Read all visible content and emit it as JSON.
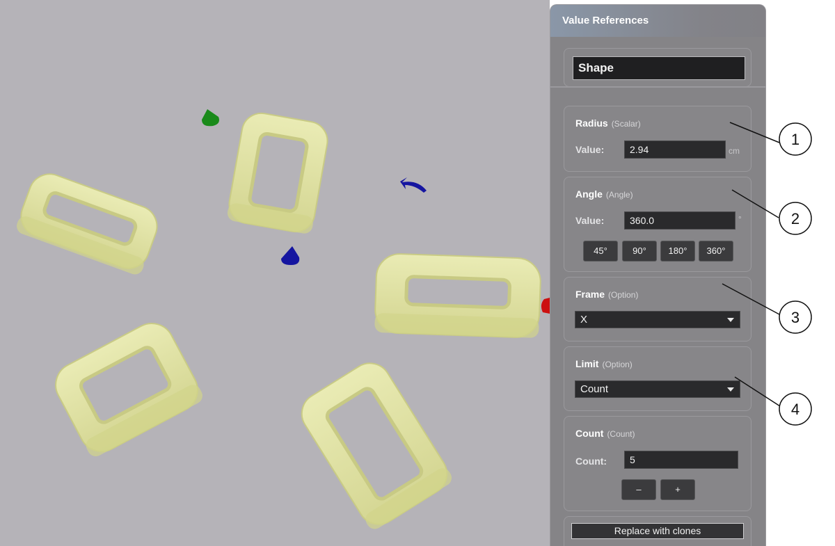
{
  "panel": {
    "title": "Value References",
    "shape_name": "Shape",
    "radius": {
      "title": "Radius",
      "type": "(Scalar)",
      "value_label": "Value:",
      "value": "2.94",
      "unit": "cm"
    },
    "angle": {
      "title": "Angle",
      "type": "(Angle)",
      "value_label": "Value:",
      "value": "360.0",
      "unit": "°",
      "presets": [
        "45°",
        "90°",
        "180°",
        "360°"
      ]
    },
    "frame": {
      "title": "Frame",
      "type": "(Option)",
      "selected": "X"
    },
    "limit": {
      "title": "Limit",
      "type": "(Option)",
      "selected": "Count"
    },
    "count": {
      "title": "Count",
      "type": "(Count)",
      "value_label": "Count:",
      "value": "5",
      "minus_label": "–",
      "plus_label": "+"
    },
    "replace_button": "Replace with clones"
  },
  "callouts": [
    "1",
    "2",
    "3",
    "4"
  ],
  "colors": {
    "viewport_bg": "#b5b3b8",
    "panel_bg": "#858487",
    "ring_fill": "#e4e5a2",
    "gizmo_green": "#1a8a1a",
    "gizmo_blue": "#1515a0",
    "gizmo_red": "#cc1010"
  }
}
